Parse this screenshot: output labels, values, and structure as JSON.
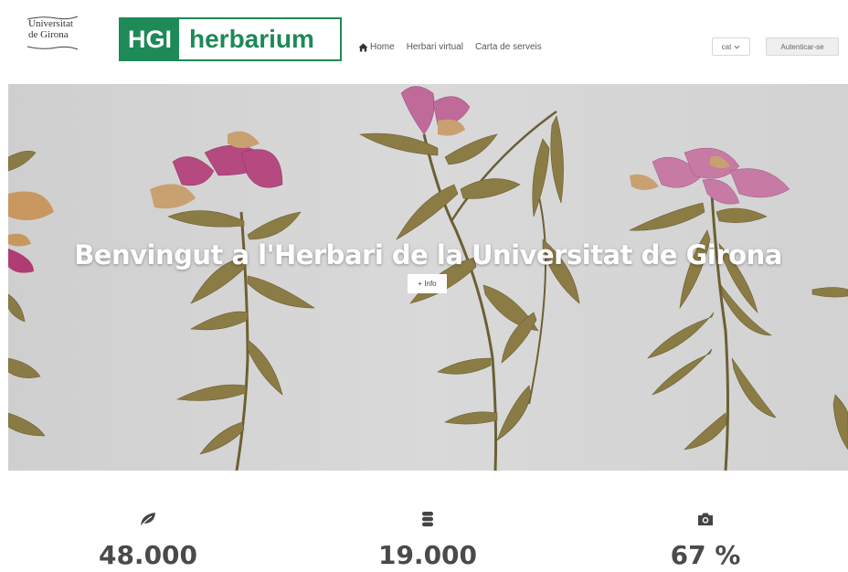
{
  "header": {
    "university_logo_lines": [
      "Universitat",
      "de Girona"
    ],
    "brand": {
      "short": "HGI",
      "name": "herbarium",
      "color": "#1d8a57"
    },
    "nav": [
      {
        "label": "Home",
        "icon": "home-icon"
      },
      {
        "label": "Herbari virtual"
      },
      {
        "label": "Carta de serveis"
      }
    ],
    "language": {
      "selected": "cat"
    },
    "auth_label": "Autenticar-se"
  },
  "hero": {
    "title": "Benvingut a l'Herbari de la Universitat de Girona",
    "button_label": "+ Info"
  },
  "stats": [
    {
      "icon": "leaf-icon",
      "value": "48.000"
    },
    {
      "icon": "database-icon",
      "value": "19.000"
    },
    {
      "icon": "camera-icon",
      "value": "67 %"
    }
  ]
}
